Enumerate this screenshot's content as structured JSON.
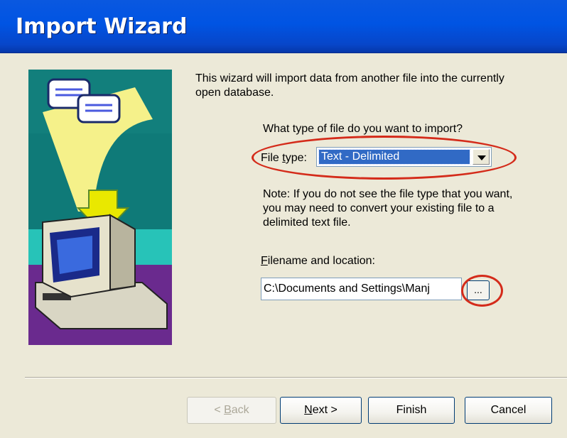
{
  "window": {
    "title": "Import Wizard"
  },
  "content": {
    "intro": "This wizard will import data from another file into the currently open database.",
    "question": "What type of file do you want to import?",
    "file_type": {
      "label_pre": "File ",
      "label_u": "t",
      "label_post": "ype:",
      "value": "Text - Delimited"
    },
    "note": "Note:  If you do not see the file type that you want, you may need to convert your existing file to a delimited text file.",
    "filename": {
      "label_u": "F",
      "label_post": "ilename and location:",
      "value": "C:\\Documents and Settings\\Manj",
      "browse_label": "..."
    }
  },
  "buttons": {
    "back": {
      "pre": "< ",
      "u": "B",
      "post": "ack"
    },
    "next": {
      "u": "N",
      "post": "ext >"
    },
    "finish": "Finish",
    "cancel": "Cancel"
  },
  "colors": {
    "titlebar": "#0054e3",
    "dialog_bg": "#ece9d8",
    "selection": "#316ac5",
    "highlight_ellipse": "#d42b1a"
  },
  "icons": [
    "wizard-illustration",
    "dropdown-arrow-icon"
  ]
}
